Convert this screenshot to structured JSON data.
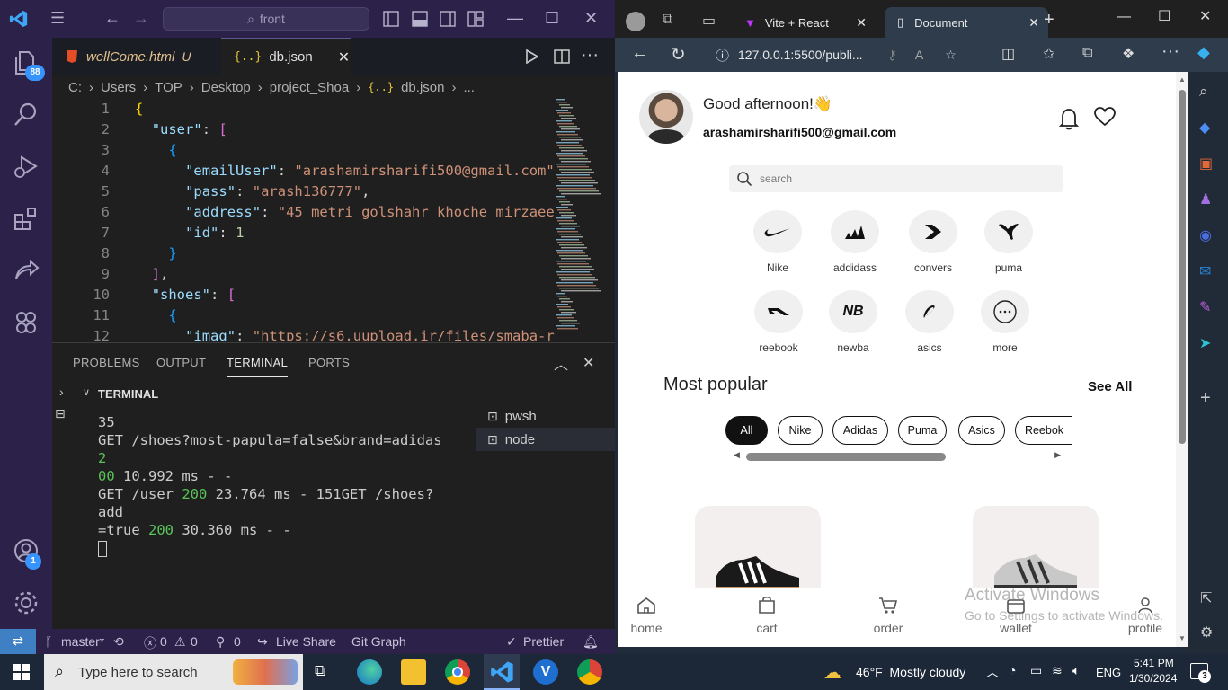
{
  "vscode": {
    "search_label": "front",
    "tabs": [
      {
        "label": "wellCome.html",
        "status": "U"
      },
      {
        "label": "db.json"
      }
    ],
    "breadcrumb": [
      "C:",
      "Users",
      "TOP",
      "Desktop",
      "project_Shoa",
      "db.json",
      "..."
    ],
    "code_lines": [
      {
        "num": "1",
        "text": "{"
      },
      {
        "num": "2",
        "text": "  \"user\": ["
      },
      {
        "num": "3",
        "text": "    {"
      },
      {
        "num": "4",
        "text": "      \"emailUser\": \"arashamirsharifi500@gmail.com\""
      },
      {
        "num": "5",
        "text": "      \"pass\": \"arash136777\","
      },
      {
        "num": "6",
        "text": "      \"address\": \"45 metri golshahr khoche mirzaee"
      },
      {
        "num": "7",
        "text": "      \"id\": 1"
      },
      {
        "num": "8",
        "text": "    }"
      },
      {
        "num": "9",
        "text": "  ],"
      },
      {
        "num": "10",
        "text": "  \"shoes\": ["
      },
      {
        "num": "11",
        "text": "    {"
      },
      {
        "num": "12",
        "text": "      \"imag\": \"https://s6.uupload.ir/files/smaba-r"
      }
    ],
    "panel_tabs": [
      "PROBLEMS",
      "OUTPUT",
      "TERMINAL",
      "PORTS"
    ],
    "terminal_header": "TERMINAL",
    "terminal_lines": [
      "35",
      "GET /shoes?most-papula=false&brand=adidas 2",
      "00 10.992 ms - -",
      "GET /user 200 23.764 ms - 151GET /shoes?add",
      "=true 200 30.360 ms - -"
    ],
    "terminal_list": [
      "pwsh",
      "node"
    ],
    "accounts_badge": "1",
    "extensions_badge": "88",
    "status": {
      "branch": "master*",
      "errors": "0",
      "warnings": "0",
      "ports": "0",
      "live_share": "Live Share",
      "git_graph": "Git Graph",
      "prettier": "Prettier"
    }
  },
  "edge": {
    "tabs": [
      {
        "label": "Vite + React"
      },
      {
        "label": "Document"
      }
    ],
    "url": "127.0.0.1:5500/publi..."
  },
  "app": {
    "greeting": "Good afternoon!👋",
    "email": "arashamirsharifi500@gmail.com",
    "search_placeholder": "search",
    "brands": [
      "Nike",
      "addidass",
      "convers",
      "puma",
      "reebook",
      "newba",
      "asics",
      "more"
    ],
    "section_title": "Most popular",
    "see_all": "See All",
    "filters": [
      "All",
      "Nike",
      "Adidas",
      "Puma",
      "Asics",
      "Reebok"
    ],
    "nav": [
      "home",
      "cart",
      "order",
      "wallet",
      "profile"
    ],
    "watermark_title": "Activate Windows",
    "watermark_sub": "Go to Settings to activate Windows."
  },
  "taskbar": {
    "search_placeholder": "Type here to search",
    "weather": "46°F  Mostly cloudy",
    "lang": "ENG",
    "time": "5:41 PM",
    "date": "1/30/2024",
    "notifications": "3"
  }
}
